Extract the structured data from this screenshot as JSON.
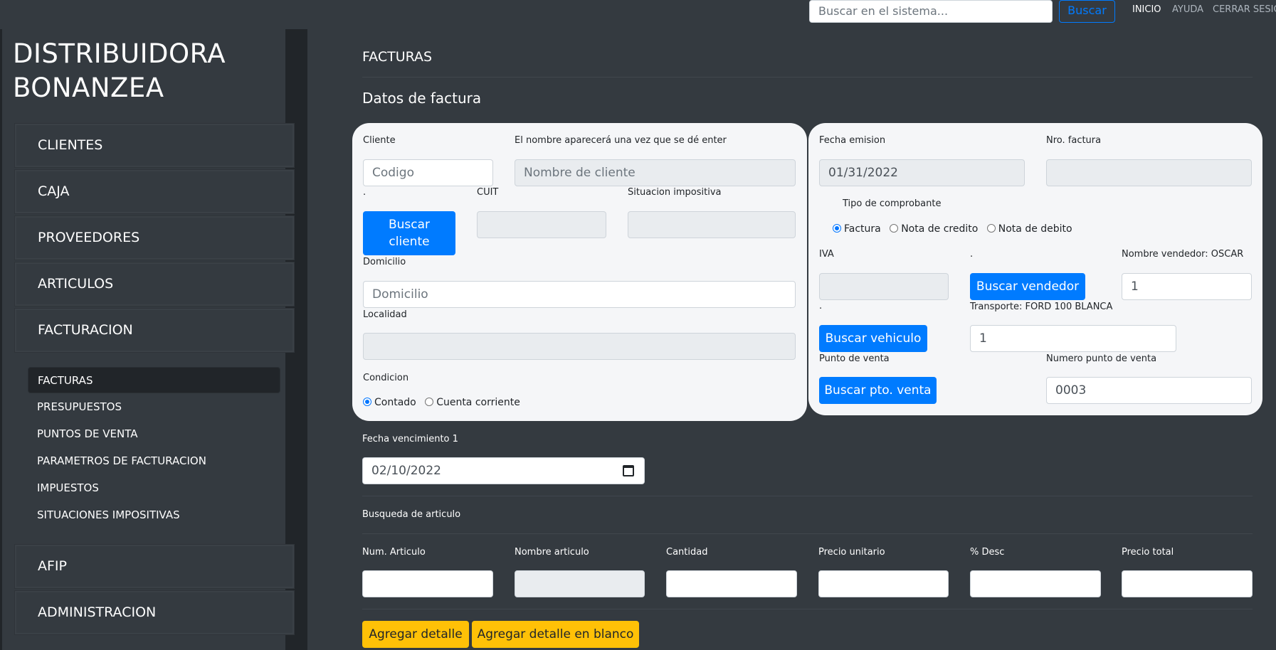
{
  "topbar": {
    "search_placeholder": "Buscar en el sistema...",
    "search_button": "Buscar",
    "nav": [
      "INICIO",
      "AYUDA",
      "CERRAR SESIO"
    ]
  },
  "sidebar": {
    "brand_line1": "DISTRIBUIDORA",
    "brand_line2": "BONANZEA",
    "items": [
      "CLIENTES",
      "CAJA",
      "PROVEEDORES",
      "ARTICULOS",
      "FACTURACION",
      "AFIP",
      "ADMINISTRACION"
    ],
    "subitems": [
      "FACTURAS",
      "PRESUPUESTOS",
      "PUNTOS DE VENTA",
      "PARAMETROS DE FACTURACION",
      "IMPUESTOS",
      "SITUACIONES IMPOSITIVAS"
    ]
  },
  "main": {
    "page_title": "FACTURAS",
    "section_title": "Datos de factura",
    "client_card": {
      "cliente_label": "Cliente",
      "codigo_placeholder": "Codigo",
      "nombre_label": "El nombre aparecerá una vez que se dé enter",
      "nombre_placeholder": "Nombre de cliente",
      "dot_label": ".",
      "cuit_label": "CUIT",
      "situacion_label": "Situacion impositiva",
      "buscar_cliente_line1": "Buscar",
      "buscar_cliente_line2": "cliente",
      "domicilio_label": "Domicilio",
      "domicilio_placeholder": "Domicilio",
      "localidad_label": "Localidad",
      "condicion_label": "Condicion",
      "condicion_options": [
        "Contado",
        "Cuenta corriente"
      ]
    },
    "invoice_card": {
      "fecha_emision_label": "Fecha emision",
      "fecha_emision_value": "01/31/2022",
      "nro_factura_label": "Nro. factura",
      "tipo_label": "Tipo de comprobante",
      "tipo_options": [
        "Factura",
        "Nota de credito",
        "Nota de debito"
      ],
      "iva_label": "IVA",
      "dot_label": ".",
      "nombre_vendedor_label": "Nombre vendedor: OSCAR",
      "buscar_vendedor": "Buscar vendedor",
      "vendedor_value": "1",
      "dot_label2": ".",
      "transporte_label": "Transporte: FORD 100 BLANCA",
      "buscar_vehiculo": "Buscar vehiculo",
      "vehiculo_value": "1",
      "punto_venta_label": "Punto de venta",
      "numero_punto_label": "Numero punto de venta",
      "buscar_pto_venta": "Buscar pto. venta",
      "numero_punto_value": "0003"
    },
    "vencimiento_label": "Fecha vencimiento 1",
    "vencimiento_value": "02/10/2022",
    "busqueda_label": "Busqueda de articulo",
    "article_columns": [
      "Num. Articulo",
      "Nombre articulo",
      "Cantidad",
      "Precio unitario",
      "% Desc",
      "Precio total"
    ],
    "agregar_detalle": "Agregar detalle",
    "agregar_detalle_blanco": "Agregar detalle en blanco"
  }
}
